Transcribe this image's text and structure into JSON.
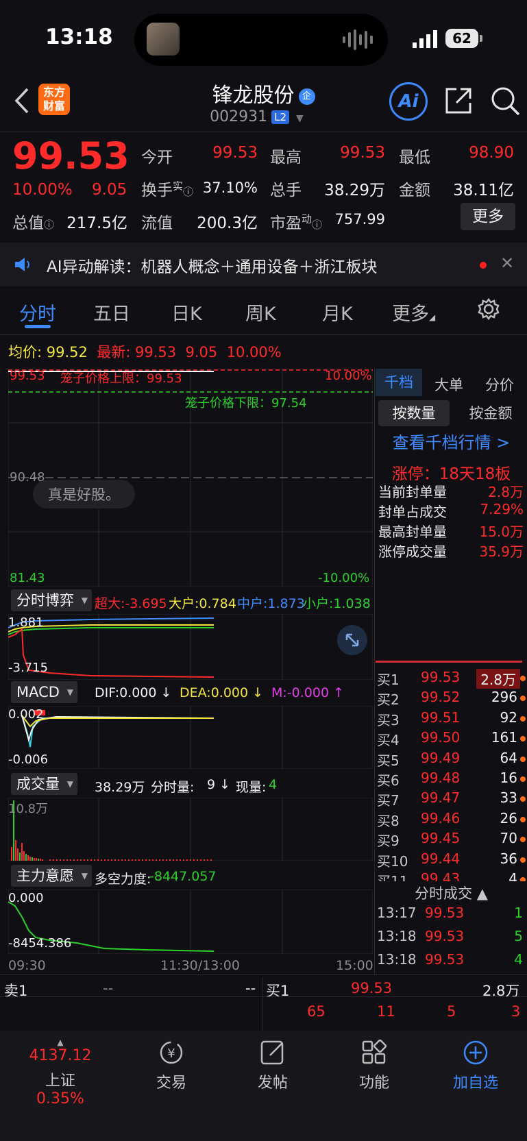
{
  "status_bar": {
    "time": "13:18",
    "battery": "62"
  },
  "header": {
    "logo_text": "东方\n财富",
    "stock_name": "锋龙股份",
    "qi_badge": "企",
    "code": "002931",
    "level_badge": "L2",
    "ai_label": "Ai"
  },
  "quote": {
    "price": "99.53",
    "change_pct": "10.00%",
    "change": "9.05",
    "open_label": "今开",
    "open": "99.53",
    "high_label": "最高",
    "high": "99.53",
    "low_label": "最低",
    "low": "98.90",
    "turnover_label": "换手",
    "turnover_sup": "实",
    "turnover": "37.10%",
    "volume_label": "总手",
    "volume": "38.29万",
    "amount_label": "金额",
    "amount": "38.11亿",
    "mktcap_label": "总值",
    "mktcap": "217.5亿",
    "float_label": "流值",
    "float": "200.3亿",
    "pe_label": "市盈",
    "pe_sup": "动",
    "pe": "757.99",
    "more_label": "更多"
  },
  "ai_bar": {
    "text": "AI异动解读：机器人概念＋通用设备＋浙江板块"
  },
  "tabs": [
    "分时",
    "五日",
    "日K",
    "周K",
    "月K",
    "更多"
  ],
  "avg_row": {
    "avg_label": "均价:",
    "avg": "99.52",
    "latest_label": "最新:",
    "latest": "99.53",
    "chg": "9.05",
    "pct": "10.00%"
  },
  "main_chart": {
    "y_top": "99.53",
    "y_mid": "90.48",
    "y_bot": "81.43",
    "pct_top": "10.00%",
    "pct_bot": "-10.00%",
    "cage_upper": "笼子价格上限：99.53",
    "cage_lower": "笼子价格下限：97.54",
    "overlay_text": "真是好股。"
  },
  "sub1": {
    "btn": "分时博弈",
    "s1": "超大:-3.695",
    "s2": "大户:0.784",
    "s3": "中户:1.873",
    "s4": "小户:1.038",
    "y_top": "1.881",
    "y_bot": "-3.715"
  },
  "sub2": {
    "btn": "MACD",
    "dif": "DIF:0.000 ↓",
    "dea": "DEA:0.000 ↓",
    "m": "M:-0.000 ↑",
    "y_top": "0.002",
    "y_bot": "-0.006"
  },
  "sub3": {
    "btn": "成交量",
    "total": "38.29万",
    "fs_label": "分时量:",
    "fs_val": "9 ↓",
    "now_label": "现量:",
    "now_val": "4",
    "y_top": "10.8万"
  },
  "sub4": {
    "btn": "主力意愿",
    "label": "多空力度:",
    "val": "-8447.057",
    "y_top": "0.000",
    "y_bot": "-8454.386"
  },
  "x_axis": {
    "start": "09:30",
    "mid": "11:30/13:00",
    "end": "15:00"
  },
  "right_panel": {
    "tabs": [
      "千档",
      "大单",
      "分价"
    ],
    "btn_qty": "按数量",
    "btn_amt": "按金额",
    "link": "查看千档行情 >",
    "zt_title": "涨停：18天18板",
    "seal": [
      {
        "label": "当前封单量",
        "value": "2.8万"
      },
      {
        "label": "封单占成交",
        "value": "7.29%"
      },
      {
        "label": "最高封单量",
        "value": "15.0万"
      },
      {
        "label": "涨停成交量",
        "value": "35.9万"
      }
    ],
    "book": [
      {
        "label": "买1",
        "price": "99.53",
        "vol": "2.8万"
      },
      {
        "label": "买2",
        "price": "99.52",
        "vol": "296"
      },
      {
        "label": "买3",
        "price": "99.51",
        "vol": "92"
      },
      {
        "label": "买4",
        "price": "99.50",
        "vol": "161"
      },
      {
        "label": "买5",
        "price": "99.49",
        "vol": "64"
      },
      {
        "label": "买6",
        "price": "99.48",
        "vol": "16"
      },
      {
        "label": "买7",
        "price": "99.47",
        "vol": "33"
      },
      {
        "label": "买8",
        "price": "99.46",
        "vol": "26"
      },
      {
        "label": "买9",
        "price": "99.45",
        "vol": "70"
      },
      {
        "label": "买10",
        "price": "99.44",
        "vol": "36"
      },
      {
        "label": "买11",
        "price": "99.43",
        "vol": "4"
      }
    ],
    "ticks_head": "分时成交 ▲",
    "ticks": [
      {
        "time": "13:17",
        "price": "99.53",
        "vol": "1"
      },
      {
        "time": "13:18",
        "price": "99.53",
        "vol": "5"
      },
      {
        "time": "13:18",
        "price": "99.53",
        "vol": "4"
      }
    ]
  },
  "bottom_book": {
    "sell_label": "卖1",
    "sell_price": "--",
    "sell_vol": "--",
    "buy_label": "买1",
    "buy_price": "99.53",
    "buy_vol": "2.8万",
    "queue": [
      "65",
      "11",
      "5",
      "3"
    ]
  },
  "navbar": {
    "index_value": "4137.12",
    "index_name": "上证",
    "index_pct": "0.35%",
    "items": [
      "交易",
      "发帖",
      "功能",
      "加自选"
    ]
  }
}
